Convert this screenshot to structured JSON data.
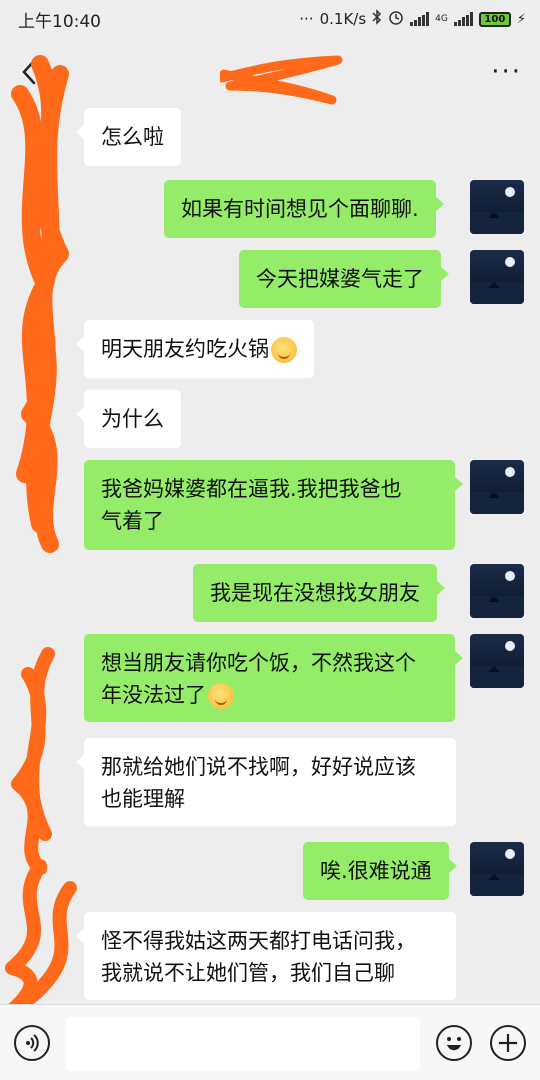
{
  "status_bar": {
    "time": "上午10:40",
    "dots": "···",
    "net_speed": "0.1K/s",
    "network_label": "4G",
    "battery": "100"
  },
  "nav": {
    "more": "···"
  },
  "messages": [
    {
      "side": "in",
      "text": "怎么啦"
    },
    {
      "side": "out",
      "text": "如果有时间想见个面聊聊."
    },
    {
      "side": "out",
      "text": "今天把媒婆气走了"
    },
    {
      "side": "in",
      "text": "明天朋友约吃火锅",
      "emoji": "smiling-face-emoji"
    },
    {
      "side": "in",
      "text": "为什么"
    },
    {
      "side": "out",
      "lines": [
        "我爸妈媒婆都在逼我.我把我爸也",
        "气着了"
      ]
    },
    {
      "side": "out",
      "text": "我是现在没想找女朋友"
    },
    {
      "side": "out",
      "lines": [
        "想当朋友请你吃个饭，不然我这个",
        "年没法过了"
      ],
      "emoji": "pleading-face-emoji"
    },
    {
      "side": "in",
      "lines": [
        "那就给她们说不找啊，好好说应该",
        "也能理解"
      ]
    },
    {
      "side": "out",
      "text": "唉.很难说通"
    },
    {
      "side": "in",
      "lines": [
        "怪不得我姑这两天都打电话问我，",
        "我就说不让她们管，我们自己聊"
      ]
    }
  ],
  "colors": {
    "background": "#ededed",
    "incoming_bubble": "#ffffff",
    "outgoing_bubble": "#95ec69",
    "redaction": "#ff6a1a"
  },
  "icons": {
    "back": "back-arrow-icon",
    "more": "more-dots-icon",
    "voice": "voice-icon",
    "emoji": "emoji-icon",
    "plus": "plus-icon"
  }
}
